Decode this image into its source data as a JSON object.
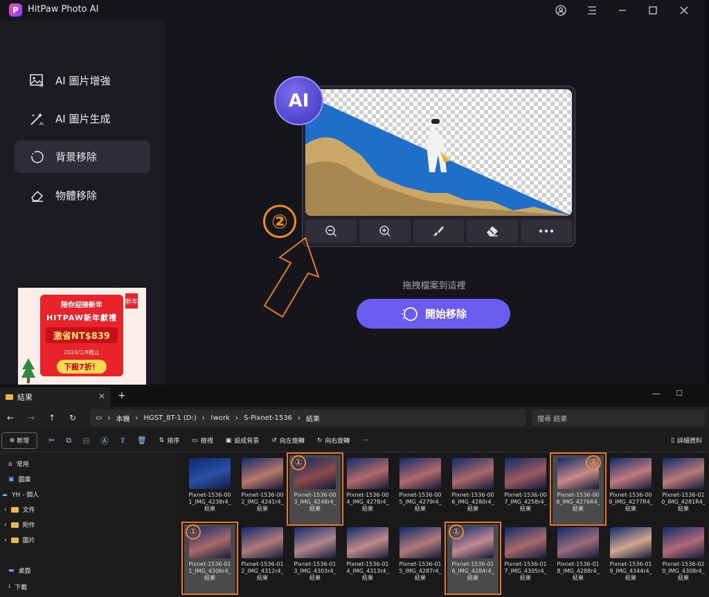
{
  "app": {
    "title": "HitPaw Photo AI",
    "logo_letter": "P"
  },
  "sidebar": {
    "items": [
      {
        "label": "AI 圖片增強",
        "icon": "image-ai-icon",
        "active": false
      },
      {
        "label": "AI 圖片生成",
        "icon": "magic-wand-icon",
        "active": false
      },
      {
        "label": "背景移除",
        "icon": "background-remove-icon",
        "active": true
      },
      {
        "label": "物體移除",
        "icon": "eraser-icon",
        "active": false
      }
    ]
  },
  "ad": {
    "line1": "陪你迎接新年",
    "line2": "HITPAW新年獻禮",
    "line3": "激省NT$839",
    "line4": "2024/1/8截止",
    "line5": "下殺7折！",
    "seal": "新年"
  },
  "main": {
    "ai_badge": "AI",
    "tools": [
      "zoom-out-icon",
      "zoom-in-icon",
      "brush-icon",
      "eraser-icon",
      "more-icon"
    ],
    "drag_hint": "拖拽檔案到這裡",
    "start_button": "開始移除",
    "annotation_2": "②"
  },
  "explorer": {
    "tab_title": "結果",
    "breadcrumbs": [
      "本機",
      "HGST_8T-1 (D:)",
      "!work",
      "S-Pixnet-1536",
      "結果"
    ],
    "search_placeholder": "搜尋 結果",
    "commands": {
      "new": "新增",
      "sort": "排序",
      "view": "檢視",
      "set_bg": "設成背景",
      "rotate_left": "向左旋轉",
      "rotate_right": "向右旋轉",
      "details": "詳細資料"
    },
    "nav": [
      {
        "label": "常用",
        "icon": "home-icon"
      },
      {
        "label": "圖庫",
        "icon": "gallery-icon"
      },
      {
        "label": "YH - 個人",
        "icon": "cloud-icon"
      },
      {
        "label": "文件",
        "icon": "folder-icon"
      },
      {
        "label": "附件",
        "icon": "folder-icon"
      },
      {
        "label": "圖片",
        "icon": "folder-icon"
      },
      {
        "label": "桌面",
        "icon": "desktop-icon"
      },
      {
        "label": "下載",
        "icon": "download-icon"
      }
    ],
    "files": [
      {
        "l1": "Pixnet-1536-00",
        "l2": "1_IMG_4238r4_",
        "l3": "結果",
        "color": "#2a4fa6"
      },
      {
        "l1": "Pixnet-1536-00",
        "l2": "2_IMG_4241r4_",
        "l3": "結果",
        "color": "#b8786a"
      },
      {
        "l1": "Pixnet-1536-00",
        "l2": "3_IMG_4248r4_",
        "l3": "結果",
        "color": "#8a4a4a"
      },
      {
        "l1": "Pixnet-1536-00",
        "l2": "4_IMG_4278r4_",
        "l3": "結果",
        "color": "#b06a6a"
      },
      {
        "l1": "Pixnet-1536-00",
        "l2": "5_IMG_4279r4_",
        "l3": "結果",
        "color": "#b06a6a"
      },
      {
        "l1": "Pixnet-1536-00",
        "l2": "6_IMG_4280r4_",
        "l3": "結果",
        "color": "#a86a6a"
      },
      {
        "l1": "Pixnet-1536-00",
        "l2": "7_IMG_4258r4_",
        "l3": "結果",
        "color": "#9a5a60"
      },
      {
        "l1": "Pixnet-1536-00",
        "l2": "8_IMG_4276R4_",
        "l3": "結果",
        "color": "#c88a86"
      },
      {
        "l1": "Pixnet-1536-00",
        "l2": "9_IMG_4277R4_",
        "l3": "結果",
        "color": "#c07a80"
      },
      {
        "l1": "Pixnet-1536-01",
        "l2": "0_IMG_4281R4_",
        "l3": "結果",
        "color": "#b87a7a"
      },
      {
        "l1": "Pixnet-1536-01",
        "l2": "1_IMG_4306r4_",
        "l3": "結果",
        "color": "#a86a6a"
      },
      {
        "l1": "Pixnet-1536-01",
        "l2": "2_IMG_4312r4_",
        "l3": "結果",
        "color": "#b07a7a"
      },
      {
        "l1": "Pixnet-1536-01",
        "l2": "3_IMG_4303r4_",
        "l3": "結果",
        "color": "#b0868a"
      },
      {
        "l1": "Pixnet-1536-01",
        "l2": "4_IMG_4313r4_",
        "l3": "結果",
        "color": "#c08a8a"
      },
      {
        "l1": "Pixnet-1536-01",
        "l2": "5_IMG_4287r4_",
        "l3": "結果",
        "color": "#b07a7a"
      },
      {
        "l1": "Pixnet-1536-01",
        "l2": "6_IMG_4284r4_",
        "l3": "結果",
        "color": "#c08a90"
      },
      {
        "l1": "Pixnet-1536-01",
        "l2": "7_IMG_4305r4_",
        "l3": "結果",
        "color": "#a86a6a"
      },
      {
        "l1": "Pixnet-1536-01",
        "l2": "8_IMG_4288r4_",
        "l3": "結果",
        "color": "#9a6a7a"
      },
      {
        "l1": "Pixnet-1536-01",
        "l2": "9_IMG_4344r4_",
        "l3": "結果",
        "color": "#d0a890"
      },
      {
        "l1": "Pixnet-1536-02",
        "l2": "0_IMG_4308r4_",
        "l3": "結果",
        "color": "#b06a7a"
      }
    ],
    "annotation_1": "①"
  }
}
